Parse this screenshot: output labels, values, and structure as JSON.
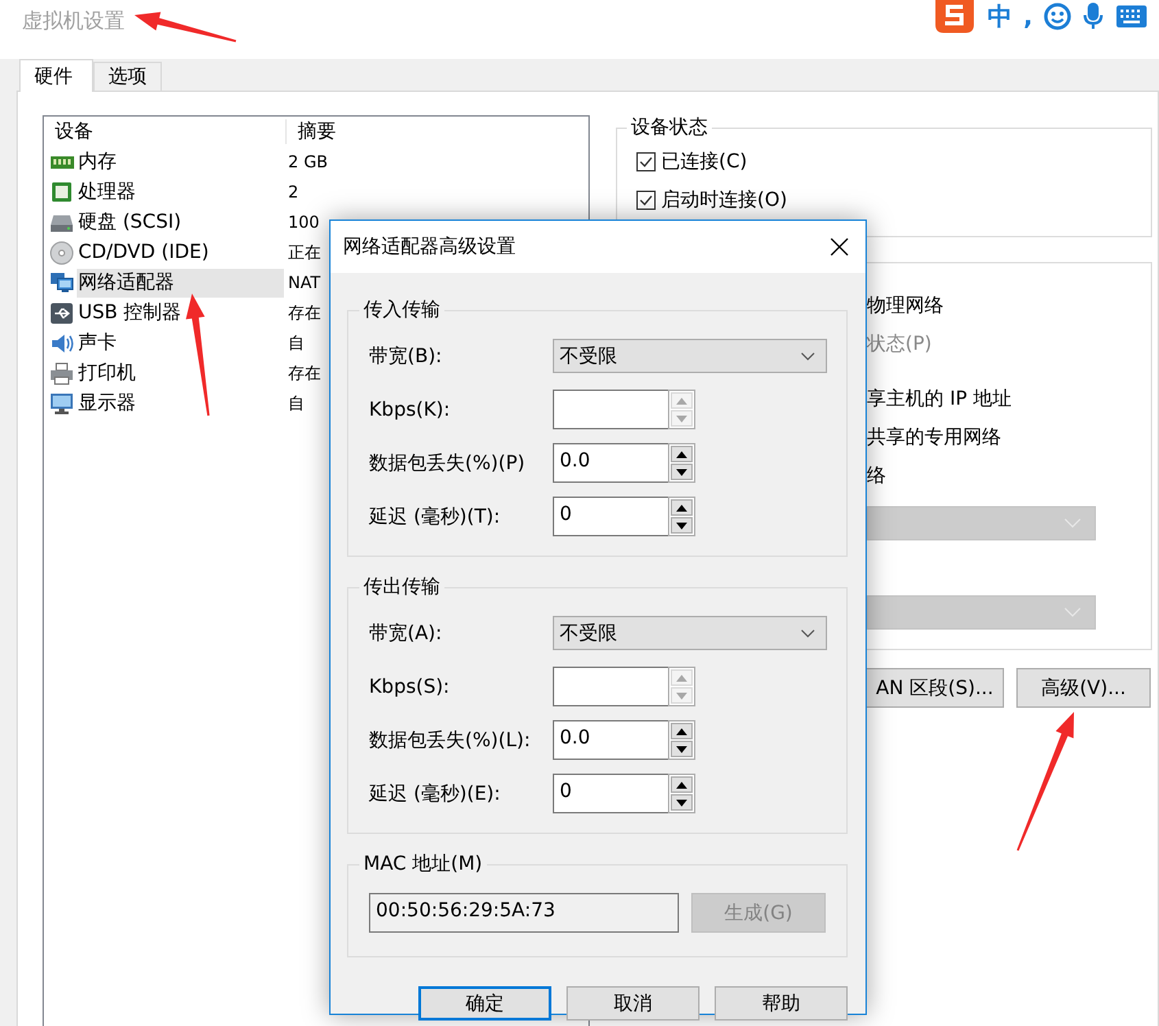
{
  "window": {
    "title": "虚拟机设置"
  },
  "ime": {
    "mode": "中",
    "punct": ","
  },
  "tabs": [
    {
      "label": "硬件",
      "selected": true
    },
    {
      "label": "选项",
      "selected": false
    }
  ],
  "devices": {
    "columns": [
      "设备",
      "摘要"
    ],
    "rows": [
      {
        "kind": "memory",
        "name": "内存",
        "summary": "2 GB",
        "selected": false
      },
      {
        "kind": "cpu",
        "name": "处理器",
        "summary": "2",
        "selected": false
      },
      {
        "kind": "disk",
        "name": "硬盘 (SCSI)",
        "summary": "100",
        "selected": false
      },
      {
        "kind": "cd",
        "name": "CD/DVD (IDE)",
        "summary": "正在",
        "selected": false
      },
      {
        "kind": "network",
        "name": "网络适配器",
        "summary": "NAT",
        "selected": true
      },
      {
        "kind": "usb",
        "name": "USB 控制器",
        "summary": "存在",
        "selected": false
      },
      {
        "kind": "sound",
        "name": "声卡",
        "summary": "自",
        "selected": false
      },
      {
        "kind": "printer",
        "name": "打印机",
        "summary": "存在",
        "selected": false
      },
      {
        "kind": "display",
        "name": "显示器",
        "summary": "自",
        "selected": false
      }
    ]
  },
  "device_status": {
    "title": "设备状态",
    "checkboxes": [
      {
        "label": "已连接(C)",
        "checked": true
      },
      {
        "label": "启动时连接(O)",
        "checked": true
      }
    ]
  },
  "network_connection": {
    "options": [
      {
        "text": "物理网络",
        "disabled": false
      },
      {
        "text": "状态(P)",
        "disabled": true
      },
      {
        "text": "享主机的 IP 地址",
        "disabled": false
      },
      {
        "text": "共享的专用网络",
        "disabled": false
      },
      {
        "text": "络",
        "disabled": false
      }
    ],
    "dropdowns": [
      {
        "disabled": true
      },
      {
        "disabled": true
      }
    ]
  },
  "buttons": [
    {
      "label": "AN 区段(S)..."
    },
    {
      "label": "高级(V)..."
    }
  ],
  "dialog": {
    "title": "网络适配器高级设置",
    "groups": [
      {
        "title": "传入传输",
        "rows": [
          {
            "kind": "select",
            "label": "带宽(B):",
            "value": "不受限",
            "disabled": false
          },
          {
            "kind": "spin",
            "label": "Kbps(K):",
            "disabled": true
          },
          {
            "kind": "spin",
            "label": "数据包丢失(%)(P)",
            "value": "0.0",
            "disabled": false
          },
          {
            "kind": "spin",
            "label": "延迟 (毫秒)(T):",
            "value": "0",
            "disabled": false
          }
        ]
      },
      {
        "title": "传出传输",
        "rows": [
          {
            "kind": "select",
            "label": "带宽(A):",
            "value": "不受限",
            "disabled": false
          },
          {
            "kind": "spin",
            "label": "Kbps(S):",
            "disabled": true
          },
          {
            "kind": "spin",
            "label": "数据包丢失(%)(L):",
            "value": "0.0",
            "disabled": false
          },
          {
            "kind": "spin",
            "label": "延迟 (毫秒)(E):",
            "value": "0",
            "disabled": false
          }
        ]
      }
    ],
    "mac": {
      "title": "MAC 地址(M)",
      "value": "00:50:56:29:5A:73",
      "button": {
        "label": "生成(G)",
        "disabled": true
      }
    },
    "buttons": [
      {
        "label": "确定",
        "default": true
      },
      {
        "label": "取消",
        "default": false
      },
      {
        "label": "帮助",
        "default": false
      }
    ]
  }
}
